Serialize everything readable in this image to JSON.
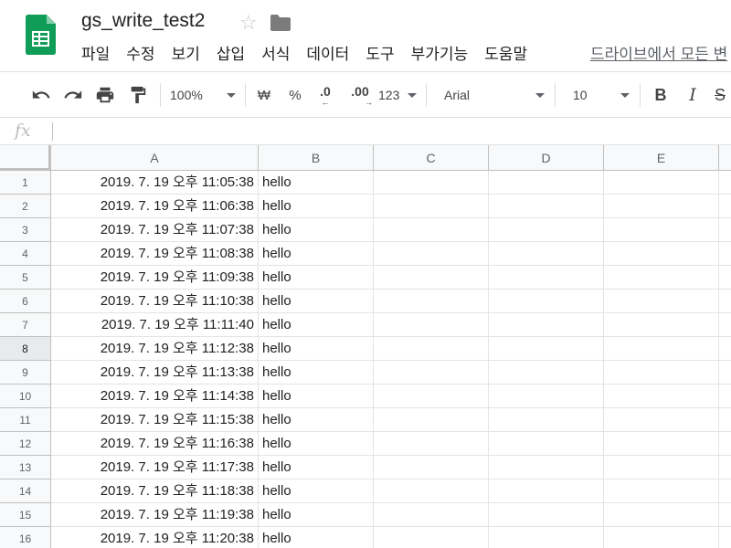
{
  "header": {
    "title": "gs_write_test2",
    "star_icon": "star-outline-icon",
    "folder_icon": "folder-icon",
    "menu": [
      "파일",
      "수정",
      "보기",
      "삽입",
      "서식",
      "데이터",
      "도구",
      "부가기능",
      "도움말"
    ],
    "last_edit_text": "드라이브에서 모든 변"
  },
  "toolbar": {
    "undo_icon": "undo-icon",
    "redo_icon": "redo-icon",
    "print_icon": "print-icon",
    "paint_format_icon": "paint-format-icon",
    "zoom": "100%",
    "currency": "₩",
    "percent": "%",
    "decrease_decimal": ".0",
    "increase_decimal": ".00",
    "more_formats": "123",
    "font": "Arial",
    "font_size": "10",
    "bold": "B",
    "italic": "I",
    "strikethrough": "S"
  },
  "formula_bar": {
    "fx_label": "fx",
    "value": ""
  },
  "grid": {
    "columns": [
      "A",
      "B",
      "C",
      "D",
      "E"
    ],
    "selected_row": 8,
    "rows": [
      {
        "n": "1",
        "a": "2019. 7. 19 오후 11:05:38",
        "b": "hello"
      },
      {
        "n": "2",
        "a": "2019. 7. 19 오후 11:06:38",
        "b": "hello"
      },
      {
        "n": "3",
        "a": "2019. 7. 19 오후 11:07:38",
        "b": "hello"
      },
      {
        "n": "4",
        "a": "2019. 7. 19 오후 11:08:38",
        "b": "hello"
      },
      {
        "n": "5",
        "a": "2019. 7. 19 오후 11:09:38",
        "b": "hello"
      },
      {
        "n": "6",
        "a": "2019. 7. 19 오후 11:10:38",
        "b": "hello"
      },
      {
        "n": "7",
        "a": "2019. 7. 19 오후 11:11:40",
        "b": "hello"
      },
      {
        "n": "8",
        "a": "2019. 7. 19 오후 11:12:38",
        "b": "hello"
      },
      {
        "n": "9",
        "a": "2019. 7. 19 오후 11:13:38",
        "b": "hello"
      },
      {
        "n": "10",
        "a": "2019. 7. 19 오후 11:14:38",
        "b": "hello"
      },
      {
        "n": "11",
        "a": "2019. 7. 19 오후 11:15:38",
        "b": "hello"
      },
      {
        "n": "12",
        "a": "2019. 7. 19 오후 11:16:38",
        "b": "hello"
      },
      {
        "n": "13",
        "a": "2019. 7. 19 오후 11:17:38",
        "b": "hello"
      },
      {
        "n": "14",
        "a": "2019. 7. 19 오후 11:18:38",
        "b": "hello"
      },
      {
        "n": "15",
        "a": "2019. 7. 19 오후 11:19:38",
        "b": "hello"
      },
      {
        "n": "16",
        "a": "2019. 7. 19 오후 11:20:38",
        "b": "hello"
      }
    ]
  },
  "colors": {
    "sheets_green": "#0f9d58",
    "grid_line": "#e2e3e3",
    "header_bg": "#f8f9fa"
  }
}
